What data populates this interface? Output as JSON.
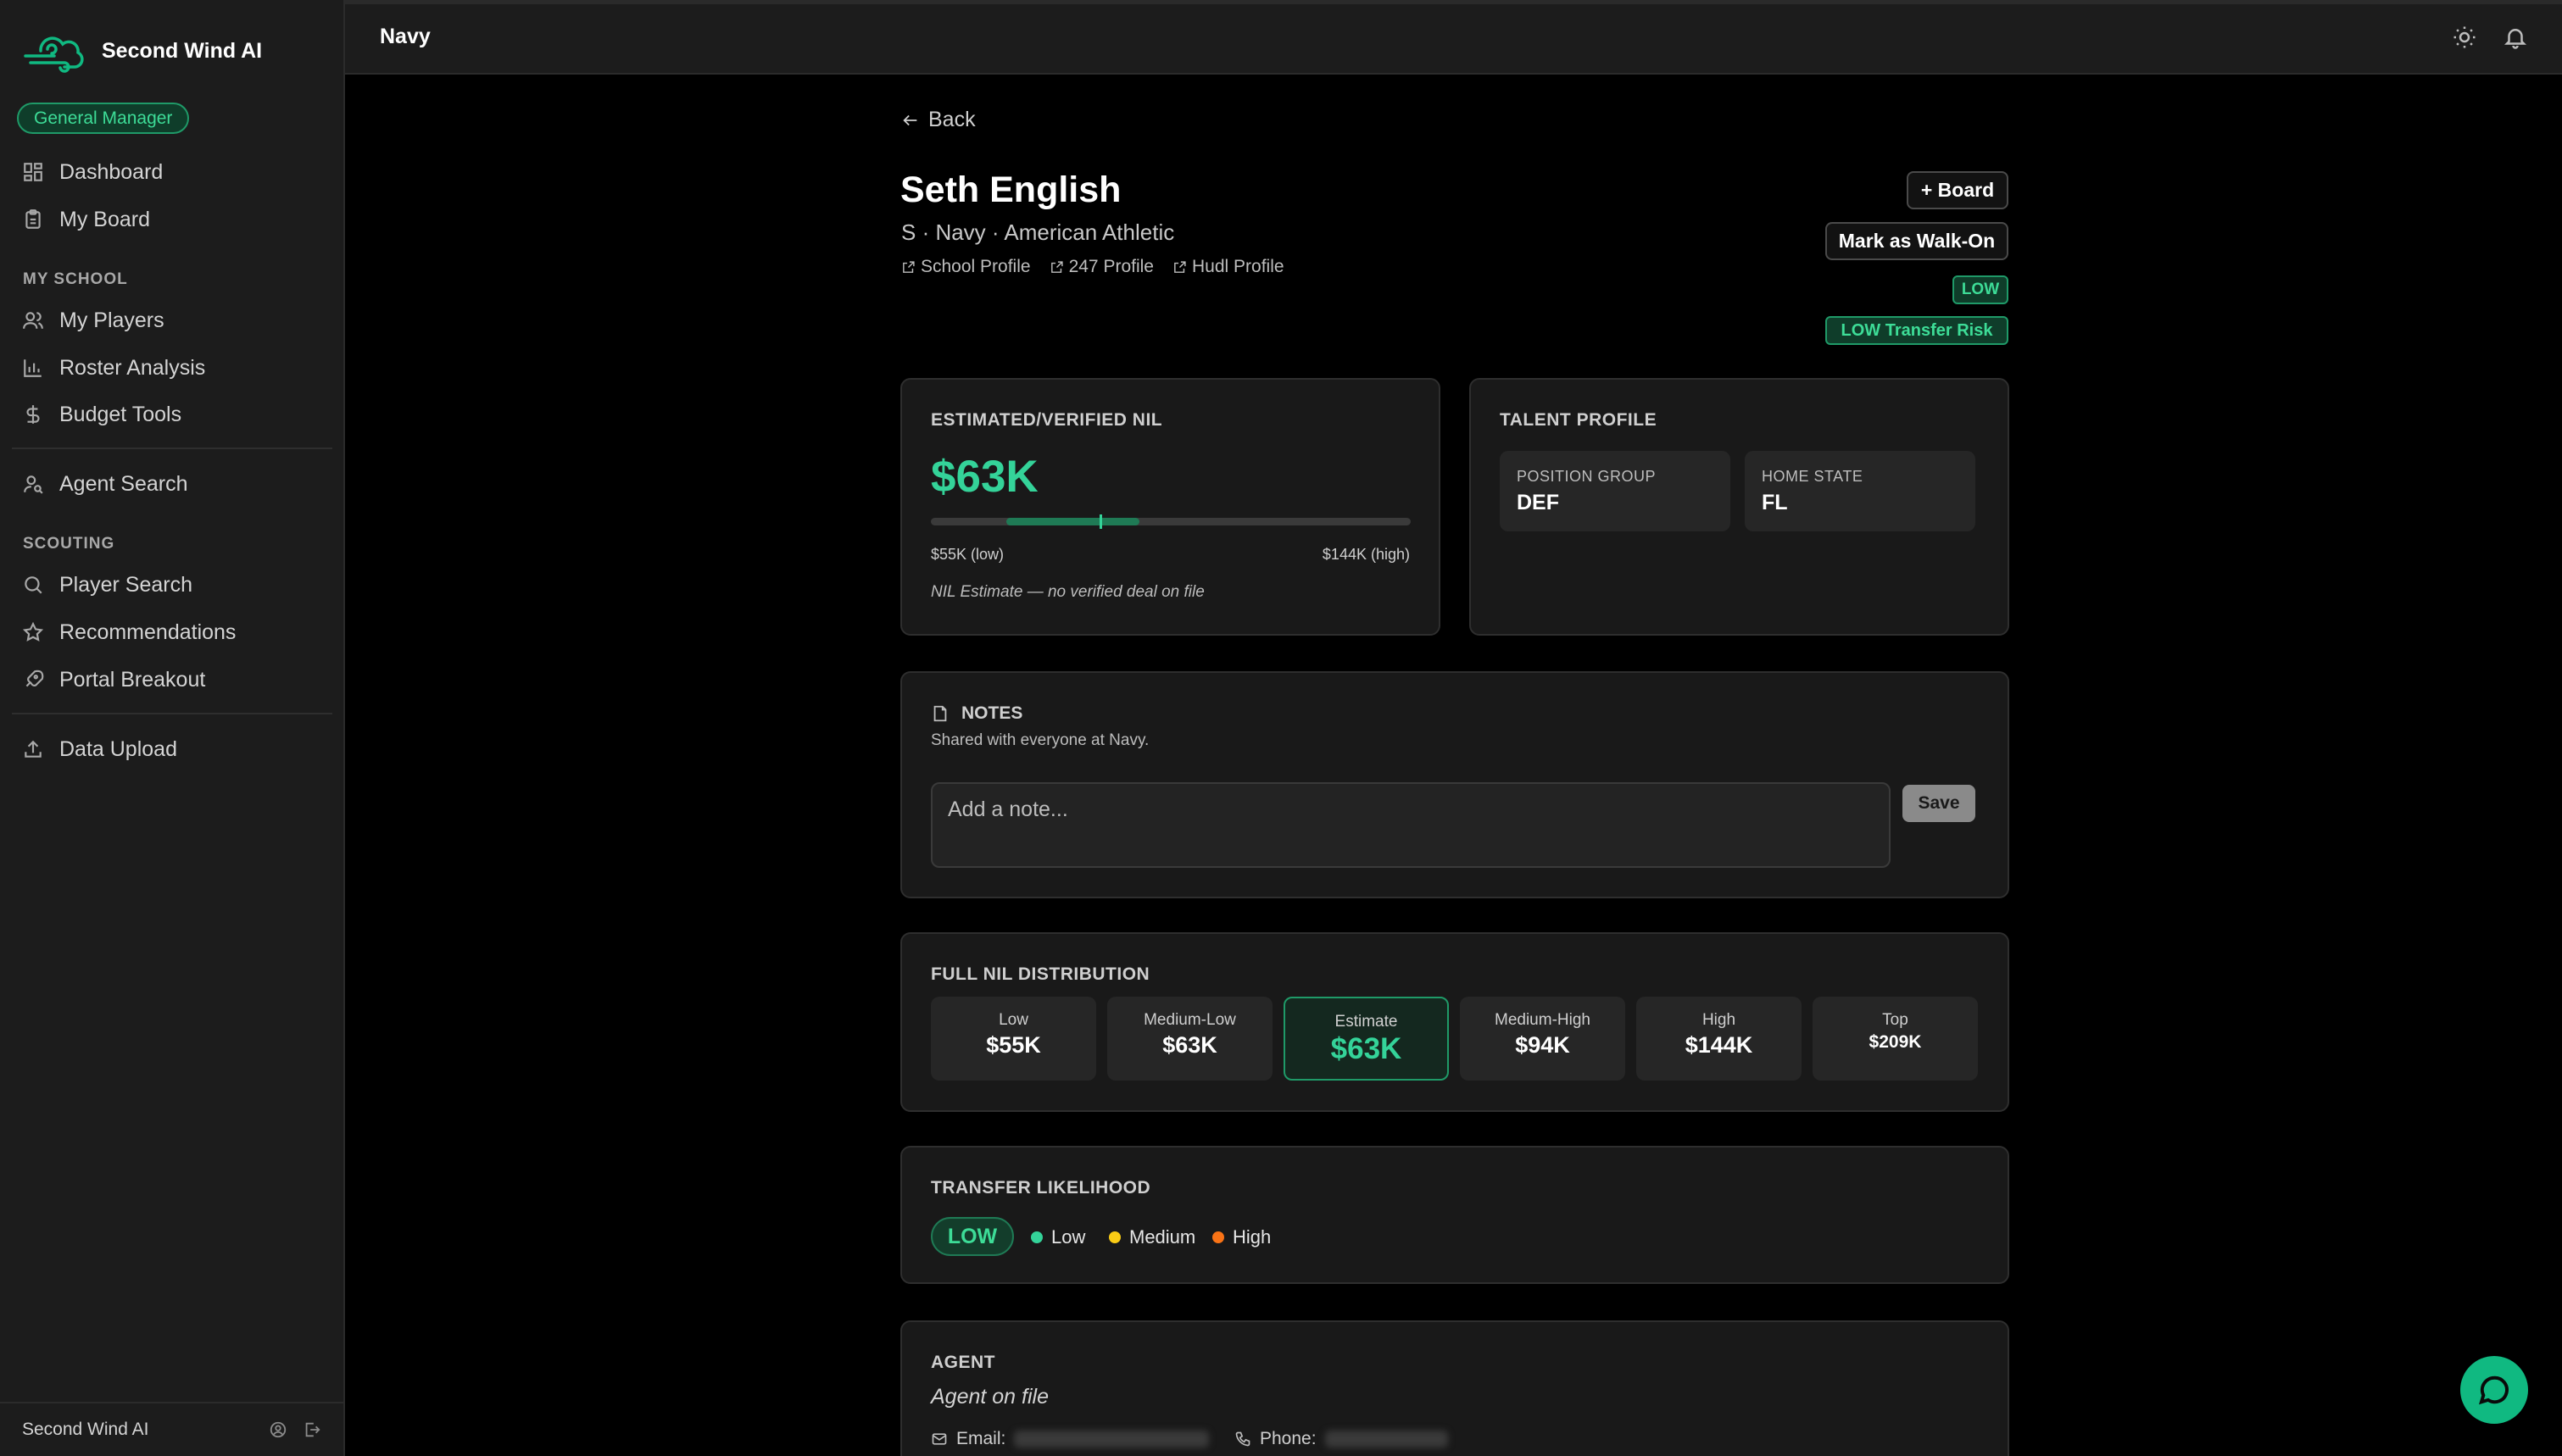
{
  "brand": {
    "name": "Second Wind AI",
    "accent": "#10b981"
  },
  "role_badge": "General Manager",
  "sidebar": {
    "items": [
      {
        "label": "Dashboard",
        "icon": "dashboard-icon"
      },
      {
        "label": "My Board",
        "icon": "clipboard-icon"
      }
    ],
    "section_my_school": "MY SCHOOL",
    "my_school_items": [
      {
        "label": "My Players",
        "icon": "users-icon"
      },
      {
        "label": "Roster Analysis",
        "icon": "bar-chart-icon"
      },
      {
        "label": "Budget Tools",
        "icon": "dollar-icon"
      }
    ],
    "agent_search": {
      "label": "Agent Search",
      "icon": "user-search-icon"
    },
    "section_scouting": "SCOUTING",
    "scouting_items": [
      {
        "label": "Player Search",
        "icon": "search-icon"
      },
      {
        "label": "Recommendations",
        "icon": "star-icon"
      },
      {
        "label": "Portal Breakout",
        "icon": "rocket-icon"
      }
    ],
    "data_upload": {
      "label": "Data Upload",
      "icon": "upload-icon"
    },
    "footer": "Second Wind AI"
  },
  "topbar": {
    "title": "Navy"
  },
  "back_label": "Back",
  "player": {
    "name": "Seth English",
    "subtitle": "S · Navy · American Athletic",
    "links": [
      "School Profile",
      "247 Profile",
      "Hudl Profile"
    ]
  },
  "actions": {
    "board": "+ Board",
    "walk_on": "Mark as Walk-On",
    "risk_short": "LOW",
    "risk_long": "LOW Transfer Risk"
  },
  "nil": {
    "title": "ESTIMATED/VERIFIED NIL",
    "value": "$63K",
    "range_low": "$55K (low)",
    "range_high": "$144K (high)",
    "note": "NIL Estimate — no verified deal on file",
    "low": 55,
    "high": 144,
    "estimate": 63,
    "scale_max": 209
  },
  "talent": {
    "title": "TALENT PROFILE",
    "position_group_label": "POSITION GROUP",
    "position_group": "DEF",
    "home_state_label": "HOME STATE",
    "home_state": "FL"
  },
  "notes": {
    "title": "NOTES",
    "subtitle": "Shared with everyone at Navy.",
    "placeholder": "Add a note...",
    "value": "",
    "save": "Save"
  },
  "distribution": {
    "title": "FULL NIL DISTRIBUTION",
    "tiers": [
      {
        "label": "Low",
        "value": "$55K"
      },
      {
        "label": "Medium-Low",
        "value": "$63K"
      },
      {
        "label": "Estimate",
        "value": "$63K"
      },
      {
        "label": "Medium-High",
        "value": "$94K"
      },
      {
        "label": "High",
        "value": "$144K"
      },
      {
        "label": "Top",
        "value": "$209K"
      }
    ]
  },
  "transfer": {
    "title": "TRANSFER LIKELIHOOD",
    "value": "LOW",
    "legend": [
      {
        "label": "Low",
        "color": "#34d399"
      },
      {
        "label": "Medium",
        "color": "#facc15"
      },
      {
        "label": "High",
        "color": "#f97316"
      }
    ]
  },
  "agent": {
    "title": "AGENT",
    "subtitle": "Agent on file",
    "email_label": "Email:",
    "phone_label": "Phone:"
  }
}
